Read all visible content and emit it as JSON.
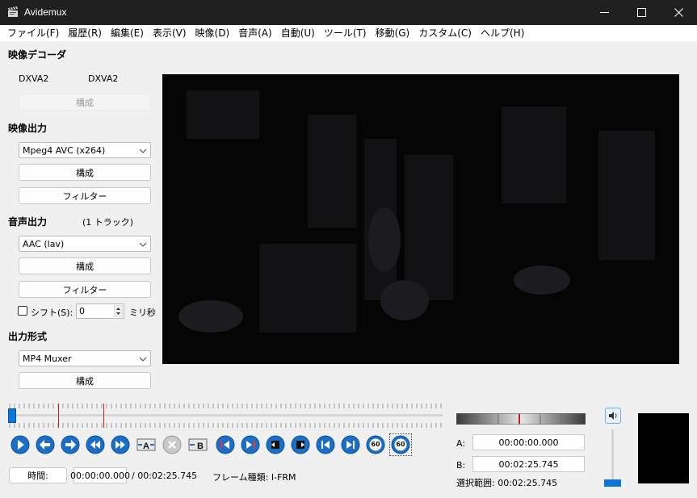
{
  "window": {
    "title": "Avidemux"
  },
  "menu": [
    "ファイル(F)",
    "履歴(R)",
    "編集(E)",
    "表示(V)",
    "映像(D)",
    "音声(A)",
    "自動(U)",
    "ツール(T)",
    "移動(G)",
    "カスタム(C)",
    "ヘルプ(H)"
  ],
  "video_decoder": {
    "title": "映像デコーダ",
    "left": "DXVA2",
    "right": "DXVA2",
    "configure": "構成"
  },
  "video_output": {
    "title": "映像出力",
    "codec": "Mpeg4 AVC (x264)",
    "configure": "構成",
    "filters": "フィルター"
  },
  "audio_output": {
    "title": "音声出力",
    "tracks": "(1 トラック)",
    "codec": "AAC (lav)",
    "configure": "構成",
    "filters": "フィルター",
    "shift_label": "シフト(S):",
    "shift_value": "0",
    "shift_unit": "ミリ秒"
  },
  "output_format": {
    "title": "出力形式",
    "muxer": "MP4 Muxer",
    "configure": "構成"
  },
  "timeline": {
    "position_fraction": 0.0,
    "marker_a_fraction": 0.115,
    "marker_b_fraction": 0.22
  },
  "status": {
    "time_button": "時間:",
    "current_time": "00:00:00.000",
    "total_time": "/ 00:02:25.745",
    "frame_type": "フレーム種類: I-FRM"
  },
  "selection": {
    "a_label": "A:",
    "a_value": "00:00:00.000",
    "b_label": "B:",
    "b_value": "00:02:25.745",
    "range": "選択範囲: 00:02:25.745"
  },
  "playback": [
    "60",
    "60"
  ],
  "colors": {
    "accent": "#0a76d6",
    "marker": "#c8201a",
    "titlebar": "#202020"
  }
}
